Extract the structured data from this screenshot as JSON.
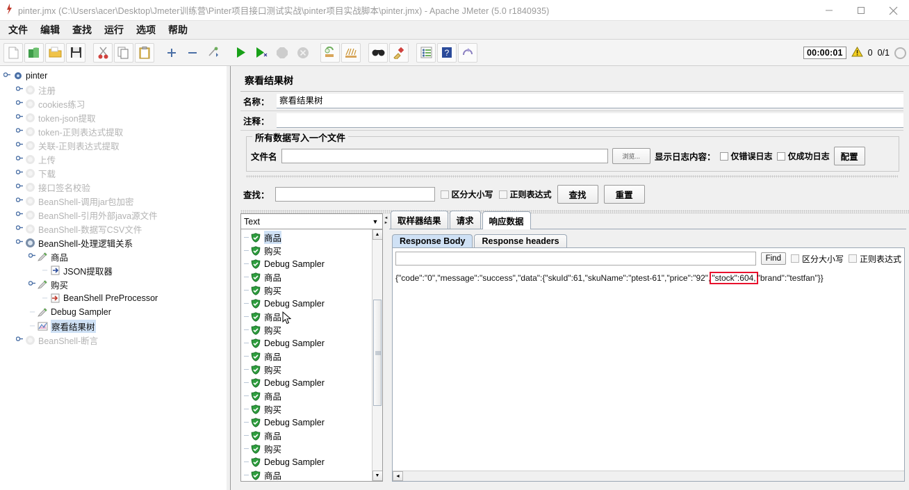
{
  "window": {
    "title": "pinter.jmx (C:\\Users\\acer\\Desktop\\Jmeter训练营\\Pinter项目接口测试实战\\pinter项目实战脚本\\pinter.jmx) - Apache JMeter (5.0 r1840935)",
    "app_icon": "jmeter-icon",
    "minimize": "minimize-icon",
    "maximize": "maximize-icon",
    "close": "close-icon"
  },
  "menu": [
    "文件",
    "编辑",
    "查找",
    "运行",
    "选项",
    "帮助"
  ],
  "toolbar": {
    "icons": [
      "new-icon",
      "templates-icon",
      "open-icon",
      "save-icon",
      "cut-icon",
      "copy-icon",
      "paste-icon",
      "expand-icon",
      "collapse-icon",
      "toggle-icon",
      "start-icon",
      "start-no-pauses-icon",
      "stop-icon",
      "shutdown-icon",
      "clear-icon",
      "clear-all-icon",
      "search-icon",
      "search-reset-icon",
      "function-helper-icon",
      "help-icon",
      "undo-icon"
    ],
    "timer": "00:00:01",
    "warning_icon": "warning-icon",
    "warning_count": "0",
    "threads": "0/1",
    "donut": "thread-donut-icon"
  },
  "tree": [
    {
      "label": "pinter",
      "depth": 0,
      "state": "active",
      "icon": "test-plan-icon",
      "handle": "expanded"
    },
    {
      "label": "注册",
      "depth": 1,
      "state": "disabled",
      "icon": "thread-group-icon",
      "handle": "collapsed"
    },
    {
      "label": "cookies练习",
      "depth": 1,
      "state": "disabled",
      "icon": "thread-group-icon",
      "handle": "collapsed"
    },
    {
      "label": "token-json提取",
      "depth": 1,
      "state": "disabled",
      "icon": "thread-group-icon",
      "handle": "collapsed"
    },
    {
      "label": "token-正则表达式提取",
      "depth": 1,
      "state": "disabled",
      "icon": "thread-group-icon",
      "handle": "collapsed"
    },
    {
      "label": "关联-正则表达式提取",
      "depth": 1,
      "state": "disabled",
      "icon": "thread-group-icon",
      "handle": "collapsed"
    },
    {
      "label": "上传",
      "depth": 1,
      "state": "disabled",
      "icon": "thread-group-icon",
      "handle": "collapsed"
    },
    {
      "label": "下载",
      "depth": 1,
      "state": "disabled",
      "icon": "thread-group-icon",
      "handle": "collapsed"
    },
    {
      "label": "接口签名校验",
      "depth": 1,
      "state": "disabled",
      "icon": "thread-group-icon",
      "handle": "collapsed"
    },
    {
      "label": "BeanShell-调用jar包加密",
      "depth": 1,
      "state": "disabled",
      "icon": "thread-group-icon",
      "handle": "collapsed"
    },
    {
      "label": "BeanShell-引用外部java源文件",
      "depth": 1,
      "state": "disabled",
      "icon": "thread-group-icon",
      "handle": "collapsed"
    },
    {
      "label": "BeanShell-数据写CSV文件",
      "depth": 1,
      "state": "disabled",
      "icon": "thread-group-icon",
      "handle": "collapsed"
    },
    {
      "label": "BeanShell-处理逻辑关系",
      "depth": 1,
      "state": "active",
      "icon": "thread-group-active-icon",
      "handle": "expanded"
    },
    {
      "label": "商品",
      "depth": 2,
      "state": "active",
      "icon": "http-sampler-icon",
      "handle": "expanded"
    },
    {
      "label": "JSON提取器",
      "depth": 3,
      "state": "active",
      "icon": "json-extractor-icon",
      "handle": "none"
    },
    {
      "label": "购买",
      "depth": 2,
      "state": "active",
      "icon": "http-sampler-icon",
      "handle": "expanded"
    },
    {
      "label": "BeanShell PreProcessor",
      "depth": 3,
      "state": "active",
      "icon": "preprocessor-icon",
      "handle": "none"
    },
    {
      "label": "Debug Sampler",
      "depth": 2,
      "state": "active",
      "icon": "http-sampler-icon",
      "handle": "none"
    },
    {
      "label": "察看结果树",
      "depth": 2,
      "state": "selected",
      "icon": "view-results-tree-icon",
      "handle": "none"
    },
    {
      "label": "BeanShell-断言",
      "depth": 1,
      "state": "disabled",
      "icon": "thread-group-icon",
      "handle": "collapsed"
    }
  ],
  "panel": {
    "title": "察看结果树",
    "name_label": "名称：",
    "name_value": "察看结果树",
    "comment_label": "注释：",
    "comment_value": "",
    "file_group_legend": "所有数据写入一个文件",
    "filename_label": "文件名",
    "filename_value": "",
    "browse_button": "浏览...",
    "log_display_label": "显示日志内容：",
    "only_error_log": "仅错误日志",
    "only_success_log": "仅成功日志",
    "config_button": "配置"
  },
  "search": {
    "label": "查找：",
    "value": "",
    "case_sensitive": "区分大小写",
    "regex": "正则表达式",
    "find_button": "查找",
    "reset_button": "重置"
  },
  "results": {
    "render_selector": "Text",
    "items": [
      {
        "label": "商品",
        "status": "success",
        "selected": true
      },
      {
        "label": "购买",
        "status": "success",
        "selected": false
      },
      {
        "label": "Debug Sampler",
        "status": "success",
        "selected": false
      },
      {
        "label": "商品",
        "status": "success",
        "selected": false
      },
      {
        "label": "购买",
        "status": "success",
        "selected": false
      },
      {
        "label": "Debug Sampler",
        "status": "success",
        "selected": false
      },
      {
        "label": "商品",
        "status": "success",
        "selected": false
      },
      {
        "label": "购买",
        "status": "success",
        "selected": false
      },
      {
        "label": "Debug Sampler",
        "status": "success",
        "selected": false
      },
      {
        "label": "商品",
        "status": "success",
        "selected": false
      },
      {
        "label": "购买",
        "status": "success",
        "selected": false
      },
      {
        "label": "Debug Sampler",
        "status": "success",
        "selected": false
      },
      {
        "label": "商品",
        "status": "success",
        "selected": false
      },
      {
        "label": "购买",
        "status": "success",
        "selected": false
      },
      {
        "label": "Debug Sampler",
        "status": "success",
        "selected": false
      },
      {
        "label": "商品",
        "status": "success",
        "selected": false
      },
      {
        "label": "购买",
        "status": "success",
        "selected": false
      },
      {
        "label": "Debug Sampler",
        "status": "success",
        "selected": false
      },
      {
        "label": "商品",
        "status": "success",
        "selected": false
      }
    ]
  },
  "detail": {
    "tabs": [
      {
        "label": "取样器结果",
        "active": false
      },
      {
        "label": "请求",
        "active": false
      },
      {
        "label": "响应数据",
        "active": true
      }
    ],
    "subtabs": [
      {
        "label": "Response Body",
        "active": true
      },
      {
        "label": "Response headers",
        "active": false
      }
    ],
    "find_value": "",
    "find_button": "Find",
    "case_sensitive": "区分大小写",
    "regex": "正则表达式",
    "response_body": {
      "before": "{\"code\":\"0\",\"message\":\"success\",\"data\":{\"skuId\":61,\"skuName\":\"ptest-61\",\"price\":\"92\",",
      "highlight": "\"stock\":604,",
      "after": "\"brand\":\"testfan\"}}"
    }
  },
  "colors": {
    "accent": "#cfe1f5",
    "highlight_border": "#e8112d",
    "success": "#2e9e3e",
    "warning": "#f2c200",
    "disabled_text": "#b3b3b3"
  }
}
